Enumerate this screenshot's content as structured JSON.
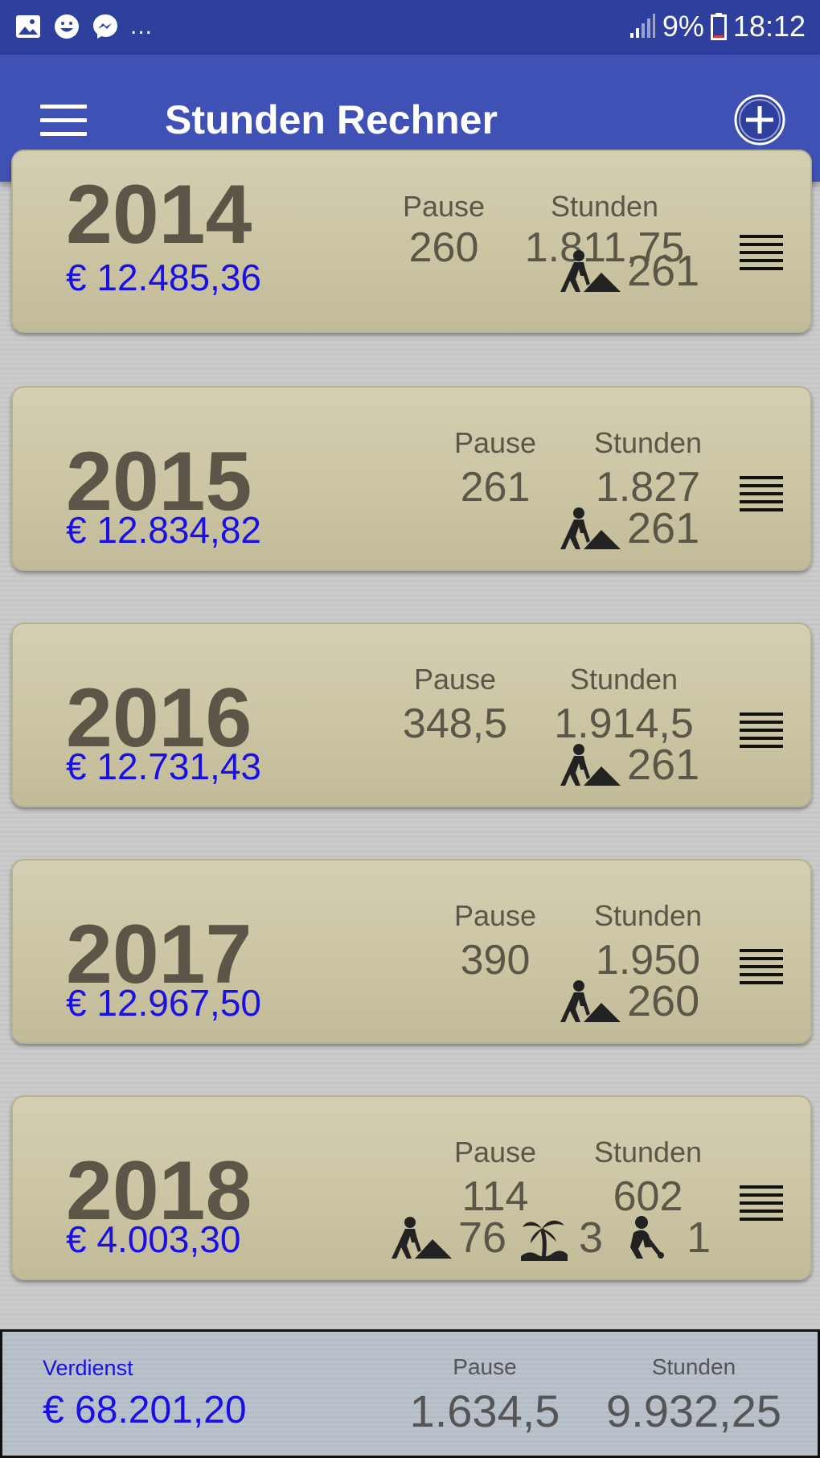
{
  "status_bar": {
    "battery": "9%",
    "time": "18:12",
    "more": "..."
  },
  "app_bar": {
    "title": "Stunden Rechner"
  },
  "labels": {
    "pause": "Pause",
    "stunden": "Stunden"
  },
  "years": [
    {
      "year": "2014",
      "amount": "€ 12.485,36",
      "pause": "260",
      "stunden": "1.811,75",
      "work_days": "261"
    },
    {
      "year": "2015",
      "amount": "€ 12.834,82",
      "pause": "261",
      "stunden": "1.827",
      "work_days": "261"
    },
    {
      "year": "2016",
      "amount": "€ 12.731,43",
      "pause": "348,5",
      "stunden": "1.914,5",
      "work_days": "261"
    },
    {
      "year": "2017",
      "amount": "€ 12.967,50",
      "pause": "390",
      "stunden": "1.950",
      "work_days": "260"
    },
    {
      "year": "2018",
      "amount": "€ 4.003,30",
      "pause": "114",
      "stunden": "602",
      "work_days": "76",
      "vacation_days": "3",
      "sick_days": "1"
    }
  ],
  "footer": {
    "verdienst_label": "Verdienst",
    "total_amount": "€ 68.201,20",
    "pause_label": "Pause",
    "stunden_label": "Stunden",
    "total_pause": "1.634,5",
    "total_stunden": "9.932,25"
  },
  "colors": {
    "app_bar": "#3f51b5",
    "status_bar": "#2e3f9e",
    "amount_text": "#1a10e6",
    "card_bg": "#cbc5a4"
  },
  "icons": [
    "image-icon",
    "smiley-icon",
    "messenger-icon",
    "signal-icon",
    "battery-icon",
    "menu-icon",
    "add-circle-icon",
    "list-icon",
    "worker-icon",
    "vacation-icon",
    "sick-icon"
  ]
}
